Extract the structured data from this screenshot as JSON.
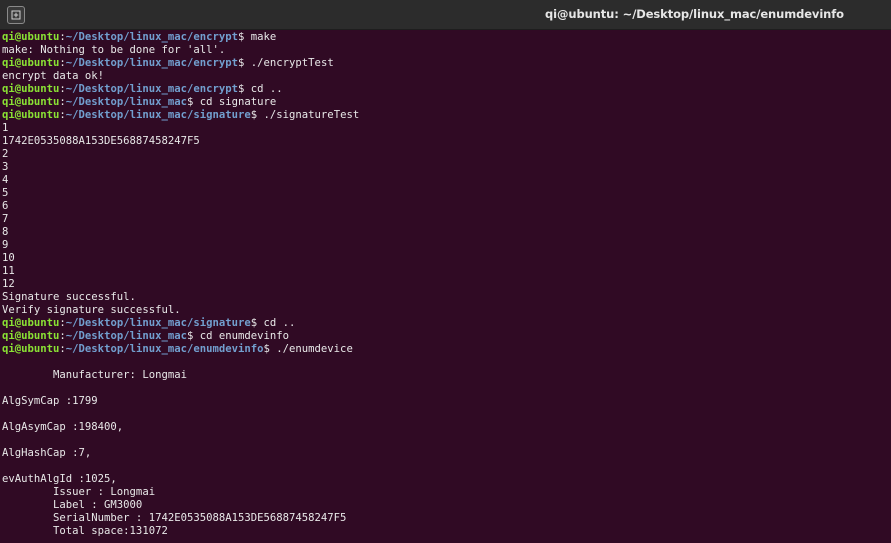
{
  "window": {
    "title": "qi@ubuntu: ~/Desktop/linux_mac/enumdevinfo",
    "new_tab_icon": "new-tab-icon"
  },
  "colors": {
    "background": "#300a24",
    "prompt_user": "#8ae234",
    "prompt_path": "#729fcf",
    "text": "#e8e8e8"
  },
  "terminal": {
    "lines": [
      {
        "type": "prompt",
        "user": "qi@ubuntu",
        "sep": ":",
        "path": "~/Desktop/linux_mac/encrypt",
        "symbol": "$ ",
        "cmd": "make"
      },
      {
        "type": "output",
        "text": "make: Nothing to be done for 'all'."
      },
      {
        "type": "prompt",
        "user": "qi@ubuntu",
        "sep": ":",
        "path": "~/Desktop/linux_mac/encrypt",
        "symbol": "$ ",
        "cmd": "./encryptTest"
      },
      {
        "type": "output",
        "text": "encrypt data ok!"
      },
      {
        "type": "prompt",
        "user": "qi@ubuntu",
        "sep": ":",
        "path": "~/Desktop/linux_mac/encrypt",
        "symbol": "$ ",
        "cmd": "cd .."
      },
      {
        "type": "prompt",
        "user": "qi@ubuntu",
        "sep": ":",
        "path": "~/Desktop/linux_mac",
        "symbol": "$ ",
        "cmd": "cd signature"
      },
      {
        "type": "prompt",
        "user": "qi@ubuntu",
        "sep": ":",
        "path": "~/Desktop/linux_mac/signature",
        "symbol": "$ ",
        "cmd": "./signatureTest"
      },
      {
        "type": "output",
        "text": "1"
      },
      {
        "type": "output",
        "text": "1742E0535088A153DE56887458247F5"
      },
      {
        "type": "output",
        "text": "2"
      },
      {
        "type": "output",
        "text": "3"
      },
      {
        "type": "output",
        "text": "4"
      },
      {
        "type": "output",
        "text": "5"
      },
      {
        "type": "output",
        "text": "6"
      },
      {
        "type": "output",
        "text": "7"
      },
      {
        "type": "output",
        "text": "8"
      },
      {
        "type": "output",
        "text": "9"
      },
      {
        "type": "output",
        "text": "10"
      },
      {
        "type": "output",
        "text": "11"
      },
      {
        "type": "output",
        "text": "12"
      },
      {
        "type": "output",
        "text": "Signature successful."
      },
      {
        "type": "output",
        "text": "Verify signature successful."
      },
      {
        "type": "prompt",
        "user": "qi@ubuntu",
        "sep": ":",
        "path": "~/Desktop/linux_mac/signature",
        "symbol": "$ ",
        "cmd": "cd .."
      },
      {
        "type": "prompt",
        "user": "qi@ubuntu",
        "sep": ":",
        "path": "~/Desktop/linux_mac",
        "symbol": "$ ",
        "cmd": "cd enumdevinfo"
      },
      {
        "type": "prompt",
        "user": "qi@ubuntu",
        "sep": ":",
        "path": "~/Desktop/linux_mac/enumdevinfo",
        "symbol": "$ ",
        "cmd": "./enumdevice"
      },
      {
        "type": "output",
        "text": ""
      },
      {
        "type": "output",
        "text": "        Manufacturer: Longmai"
      },
      {
        "type": "output",
        "text": ""
      },
      {
        "type": "output",
        "text": "AlgSymCap :1799"
      },
      {
        "type": "output",
        "text": ""
      },
      {
        "type": "output",
        "text": "AlgAsymCap :198400,"
      },
      {
        "type": "output",
        "text": ""
      },
      {
        "type": "output",
        "text": "AlgHashCap :7,"
      },
      {
        "type": "output",
        "text": ""
      },
      {
        "type": "output",
        "text": "evAuthAlgId :1025,"
      },
      {
        "type": "output",
        "text": "        Issuer : Longmai"
      },
      {
        "type": "output",
        "text": "        Label : GM3000"
      },
      {
        "type": "output",
        "text": "        SerialNumber : 1742E0535088A153DE56887458247F5"
      },
      {
        "type": "output",
        "text": "        Total space:131072"
      }
    ]
  }
}
